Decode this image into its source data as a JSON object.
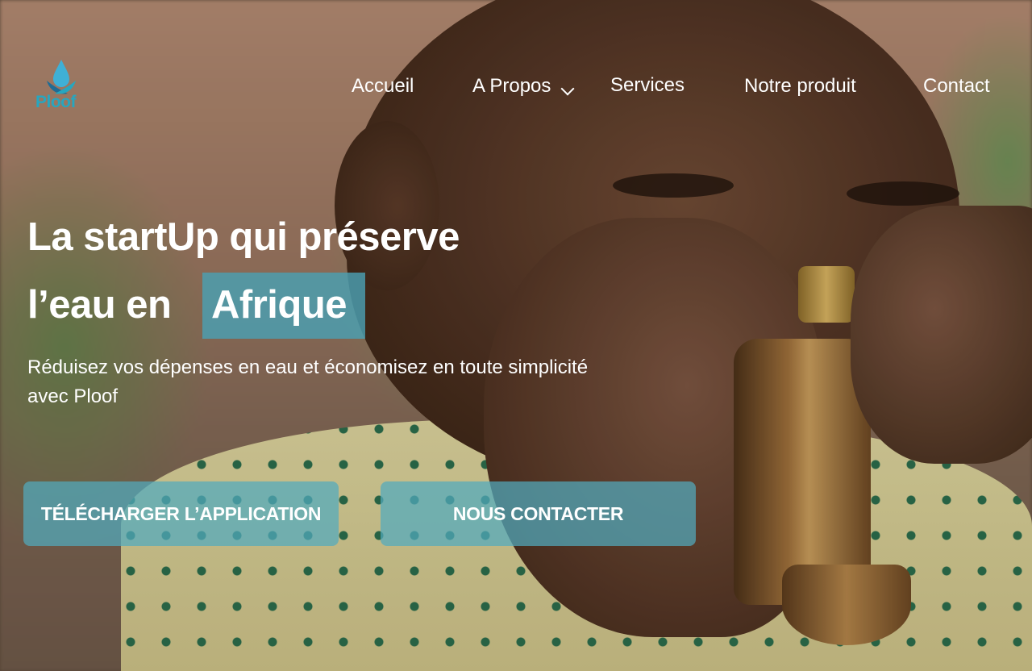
{
  "brand": {
    "name": "Ploof",
    "color": "#27a6bf"
  },
  "nav": {
    "items": [
      {
        "label": "Accueil"
      },
      {
        "label": "A Propos",
        "has_dropdown": true,
        "icon": "chevron-down-icon"
      },
      {
        "label": "Services"
      },
      {
        "label": "Notre produit"
      },
      {
        "label": "Contact"
      }
    ]
  },
  "hero": {
    "title_line1": "La startUp qui préserve",
    "title_line2_prefix": "l’eau en",
    "title_highlight": "Afrique",
    "subtitle": "Réduisez vos dépenses en eau et économisez en toute simplicité avec Ploof",
    "highlight_color": "#4aa0b2",
    "background_image": "child drinking from brass water tap"
  },
  "cta": {
    "download_label": "TÉLÉCHARGER L’APPLICATION",
    "contact_label": "NOUS CONTACTER",
    "button_color": "#52aabe"
  }
}
